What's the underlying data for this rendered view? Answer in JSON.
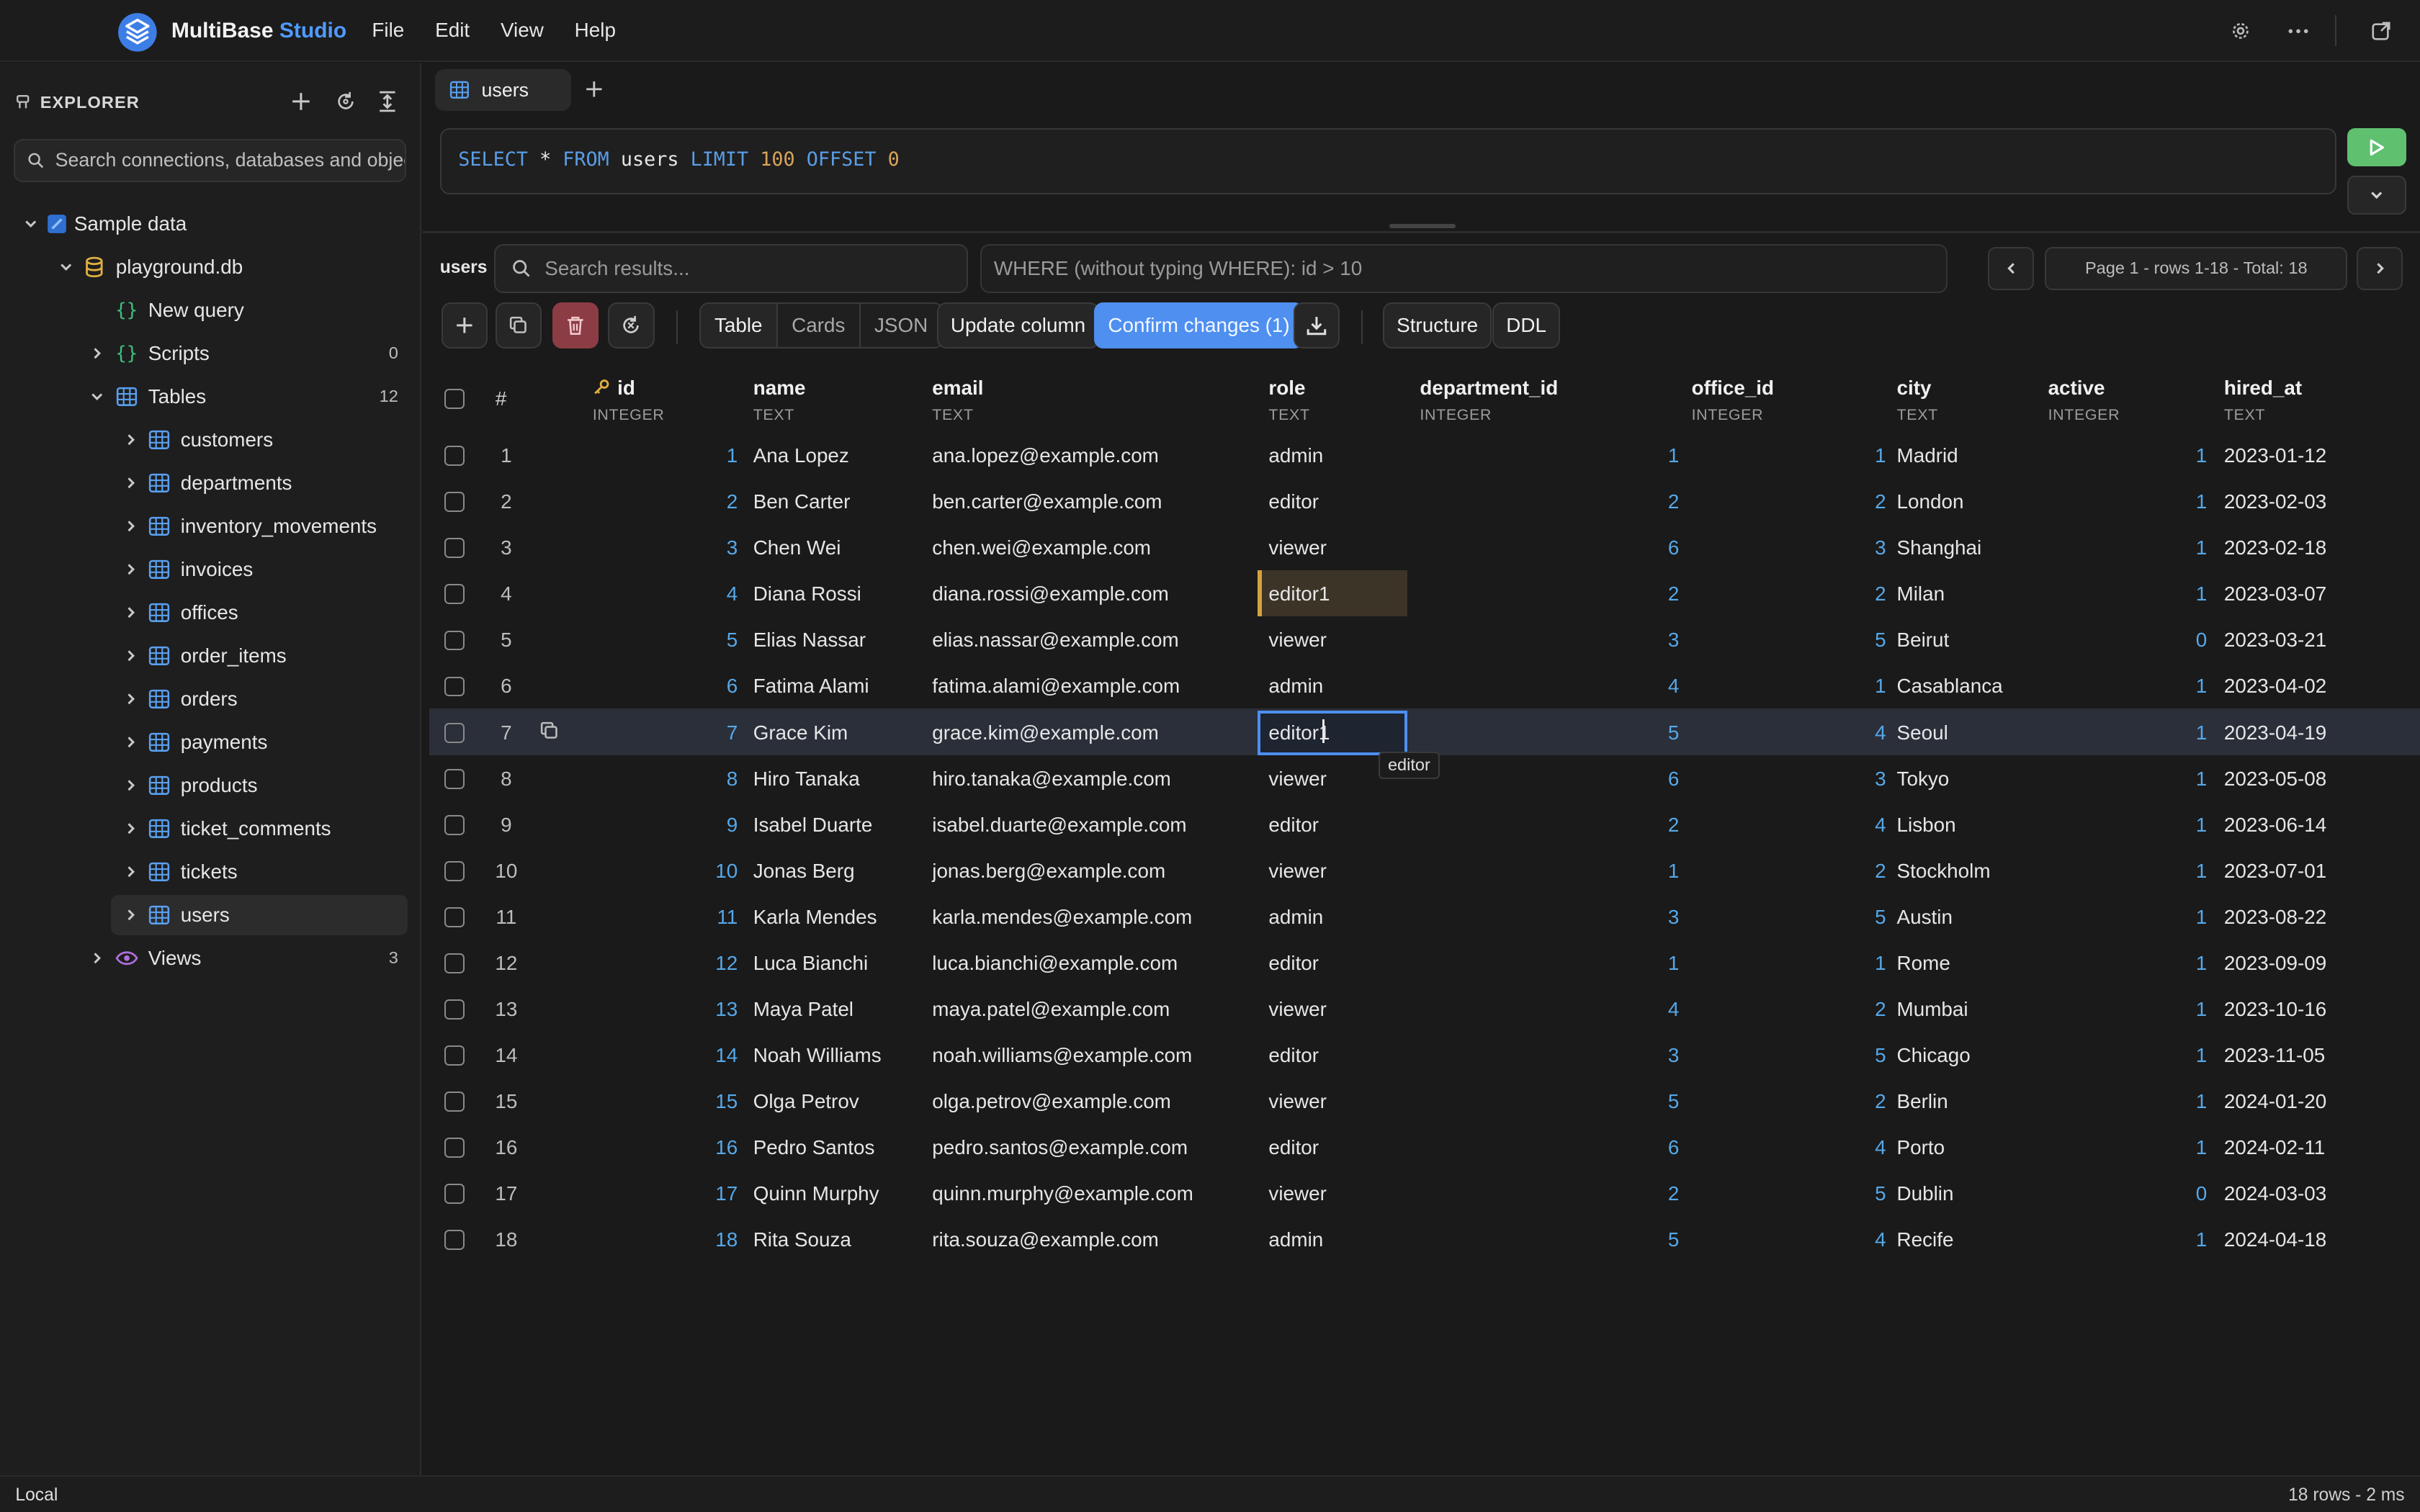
{
  "app": {
    "brand_main": "MultiBase",
    "brand_accent": "Studio"
  },
  "menu": [
    "File",
    "Edit",
    "View",
    "Help"
  ],
  "sidebar": {
    "title": "EXPLORER",
    "search_placeholder": "Search connections, databases and objects",
    "connection": "Sample data",
    "database": "playground.db",
    "new_query": "New query",
    "scripts": {
      "label": "Scripts",
      "count": "0"
    },
    "tables": {
      "label": "Tables",
      "count": "12"
    },
    "table_list": [
      "customers",
      "departments",
      "inventory_movements",
      "invoices",
      "offices",
      "order_items",
      "orders",
      "payments",
      "products",
      "ticket_comments",
      "tickets",
      "users"
    ],
    "selected_table": "users",
    "views": {
      "label": "Views",
      "count": "3"
    }
  },
  "tab": {
    "label": "users"
  },
  "query": {
    "tokens": [
      {
        "t": "SELECT",
        "k": "kw"
      },
      {
        "t": " * ",
        "k": "id-tok"
      },
      {
        "t": "FROM",
        "k": "kw"
      },
      {
        "t": " users ",
        "k": "id-tok"
      },
      {
        "t": "LIMIT",
        "k": "kw"
      },
      {
        "t": " ",
        "k": "id-tok"
      },
      {
        "t": "100",
        "k": "num"
      },
      {
        "t": " ",
        "k": "id-tok"
      },
      {
        "t": "OFFSET",
        "k": "kw"
      },
      {
        "t": " ",
        "k": "id-tok"
      },
      {
        "t": "0",
        "k": "num"
      }
    ]
  },
  "results": {
    "table_label": "users",
    "search_placeholder": "Search results...",
    "where_placeholder": "WHERE (without typing WHERE): id > 10",
    "page_info": "Page 1 - rows 1-18 - Total: 18"
  },
  "toolbar": {
    "views": [
      "Table",
      "Cards",
      "JSON"
    ],
    "active_view": "Table",
    "update_column": "Update column",
    "confirm_changes": "Confirm changes (1)",
    "structure": "Structure",
    "ddl": "DDL"
  },
  "grid": {
    "rownum_header": "#",
    "columns": [
      {
        "name": "id",
        "type": "INTEGER",
        "pk": true
      },
      {
        "name": "name",
        "type": "TEXT"
      },
      {
        "name": "email",
        "type": "TEXT"
      },
      {
        "name": "role",
        "type": "TEXT"
      },
      {
        "name": "department_id",
        "type": "INTEGER"
      },
      {
        "name": "office_id",
        "type": "INTEGER"
      },
      {
        "name": "city",
        "type": "TEXT"
      },
      {
        "name": "active",
        "type": "INTEGER"
      },
      {
        "name": "hired_at",
        "type": "TEXT"
      }
    ],
    "rows": [
      [
        "1",
        "Ana Lopez",
        "ana.lopez@example.com",
        "admin",
        "1",
        "1",
        "Madrid",
        "1",
        "2023-01-12"
      ],
      [
        "2",
        "Ben Carter",
        "ben.carter@example.com",
        "editor",
        "2",
        "2",
        "London",
        "1",
        "2023-02-03"
      ],
      [
        "3",
        "Chen Wei",
        "chen.wei@example.com",
        "viewer",
        "6",
        "3",
        "Shanghai",
        "1",
        "2023-02-18"
      ],
      [
        "4",
        "Diana Rossi",
        "diana.rossi@example.com",
        "editor1",
        "2",
        "2",
        "Milan",
        "1",
        "2023-03-07"
      ],
      [
        "5",
        "Elias Nassar",
        "elias.nassar@example.com",
        "viewer",
        "3",
        "5",
        "Beirut",
        "0",
        "2023-03-21"
      ],
      [
        "6",
        "Fatima Alami",
        "fatima.alami@example.com",
        "admin",
        "4",
        "1",
        "Casablanca",
        "1",
        "2023-04-02"
      ],
      [
        "7",
        "Grace Kim",
        "grace.kim@example.com",
        "editor1",
        "5",
        "4",
        "Seoul",
        "1",
        "2023-04-19"
      ],
      [
        "8",
        "Hiro Tanaka",
        "hiro.tanaka@example.com",
        "viewer",
        "6",
        "3",
        "Tokyo",
        "1",
        "2023-05-08"
      ],
      [
        "9",
        "Isabel Duarte",
        "isabel.duarte@example.com",
        "editor",
        "2",
        "4",
        "Lisbon",
        "1",
        "2023-06-14"
      ],
      [
        "10",
        "Jonas Berg",
        "jonas.berg@example.com",
        "viewer",
        "1",
        "2",
        "Stockholm",
        "1",
        "2023-07-01"
      ],
      [
        "11",
        "Karla Mendes",
        "karla.mendes@example.com",
        "admin",
        "3",
        "5",
        "Austin",
        "1",
        "2023-08-22"
      ],
      [
        "12",
        "Luca Bianchi",
        "luca.bianchi@example.com",
        "editor",
        "1",
        "1",
        "Rome",
        "1",
        "2023-09-09"
      ],
      [
        "13",
        "Maya Patel",
        "maya.patel@example.com",
        "viewer",
        "4",
        "2",
        "Mumbai",
        "1",
        "2023-10-16"
      ],
      [
        "14",
        "Noah Williams",
        "noah.williams@example.com",
        "editor",
        "3",
        "5",
        "Chicago",
        "1",
        "2023-11-05"
      ],
      [
        "15",
        "Olga Petrov",
        "olga.petrov@example.com",
        "viewer",
        "5",
        "2",
        "Berlin",
        "1",
        "2024-01-20"
      ],
      [
        "16",
        "Pedro Santos",
        "pedro.santos@example.com",
        "editor",
        "6",
        "4",
        "Porto",
        "1",
        "2024-02-11"
      ],
      [
        "17",
        "Quinn Murphy",
        "quinn.murphy@example.com",
        "viewer",
        "2",
        "5",
        "Dublin",
        "0",
        "2024-03-03"
      ],
      [
        "18",
        "Rita Souza",
        "rita.souza@example.com",
        "admin",
        "5",
        "4",
        "Recife",
        "1",
        "2024-04-18"
      ]
    ],
    "edited_row": 4,
    "editing_row": 7,
    "tooltip": "editor"
  },
  "status": {
    "left": "Local",
    "right": "18 rows - 2 ms"
  },
  "colors": {
    "accent": "#4f9bff",
    "run": "#5fc070",
    "danger": "#8c3c44",
    "edited": "#d6a23c"
  }
}
